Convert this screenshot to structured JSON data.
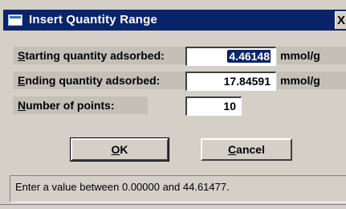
{
  "window": {
    "title": "Insert Quantity Range",
    "close_glyph": "X"
  },
  "fields": [
    {
      "label_accel": "S",
      "label_rest": "tarting quantity adsorbed:",
      "value": "4.46148",
      "unit": "mmol/g",
      "selected": true
    },
    {
      "label_accel": "E",
      "label_rest": "nding quantity adsorbed:",
      "value": "17.84591",
      "unit": "mmol/g",
      "selected": false
    },
    {
      "label_accel": "N",
      "label_rest": "umber of points:",
      "value": "10",
      "unit": "",
      "selected": false
    }
  ],
  "buttons": {
    "ok_accel": "O",
    "ok_rest": "K",
    "cancel_accel": "C",
    "cancel_rest": "ancel"
  },
  "status": {
    "message": "Enter a value between 0.00000 and 44.61477."
  },
  "colors": {
    "title_bar": "#0a246a",
    "dialog_face": "#d4d0c8",
    "selection": "#0a246a"
  }
}
